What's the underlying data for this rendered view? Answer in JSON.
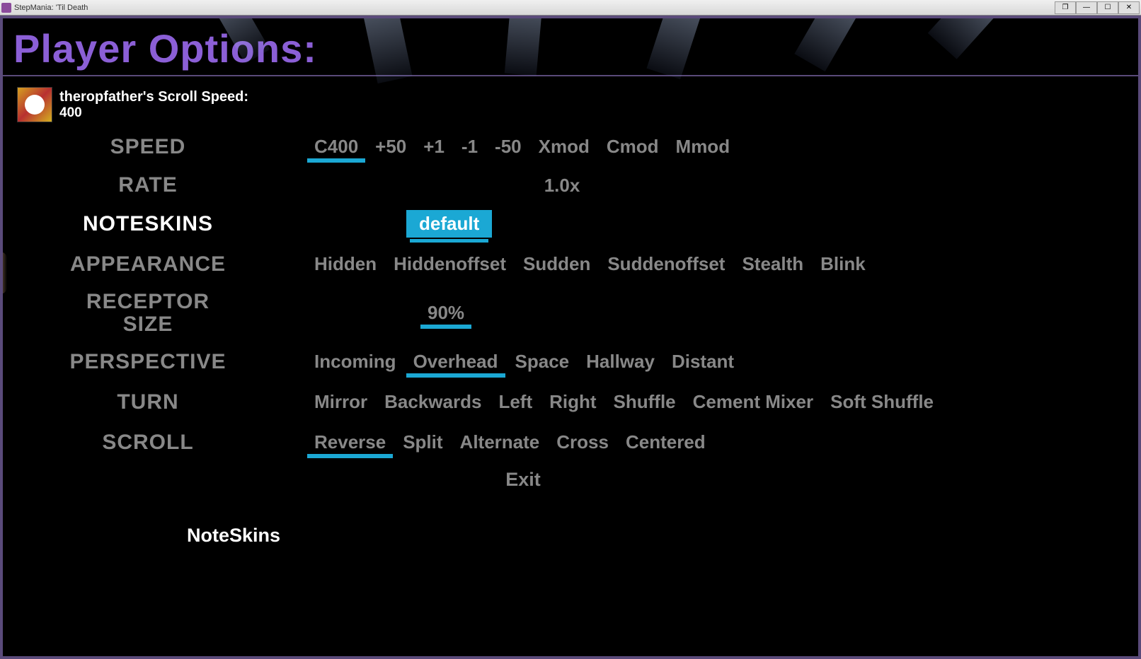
{
  "window": {
    "title": "StepMania: 'Til Death",
    "min": "—",
    "max": "☐",
    "close": "✕",
    "extra": "❐"
  },
  "page_title": "Player Options:",
  "profile": {
    "label": "theropfather's Scroll Speed:",
    "value": "400"
  },
  "rows": {
    "speed": {
      "label": "SPEED",
      "options": {
        "c400": "C400",
        "plus50": "+50",
        "plus1": "+1",
        "minus1": "-1",
        "minus50": "-50",
        "xmod": "Xmod",
        "cmod": "Cmod",
        "mmod": "Mmod"
      }
    },
    "rate": {
      "label": "RATE",
      "value": "1.0x"
    },
    "noteskins": {
      "label": "NOTESKINS",
      "value": "default"
    },
    "appearance": {
      "label": "APPEARANCE",
      "options": {
        "hidden": "Hidden",
        "hiddenoffset": "Hiddenoffset",
        "sudden": "Sudden",
        "suddenoffset": "Suddenoffset",
        "stealth": "Stealth",
        "blink": "Blink"
      }
    },
    "receptor": {
      "label_line1": "RECEPTOR",
      "label_line2": "SIZE",
      "value": "90%"
    },
    "perspective": {
      "label": "PERSPECTIVE",
      "options": {
        "incoming": "Incoming",
        "overhead": "Overhead",
        "space": "Space",
        "hallway": "Hallway",
        "distant": "Distant"
      }
    },
    "turn": {
      "label": "TURN",
      "options": {
        "mirror": "Mirror",
        "backwards": "Backwards",
        "left": "Left",
        "right": "Right",
        "shuffle": "Shuffle",
        "cement": "Cement Mixer",
        "soft": "Soft Shuffle"
      }
    },
    "scroll": {
      "label": "SCROLL",
      "options": {
        "reverse": "Reverse",
        "split": "Split",
        "alternate": "Alternate",
        "cross": "Cross",
        "centered": "Centered"
      }
    }
  },
  "exit_label": "Exit",
  "footer_label": "NoteSkins"
}
